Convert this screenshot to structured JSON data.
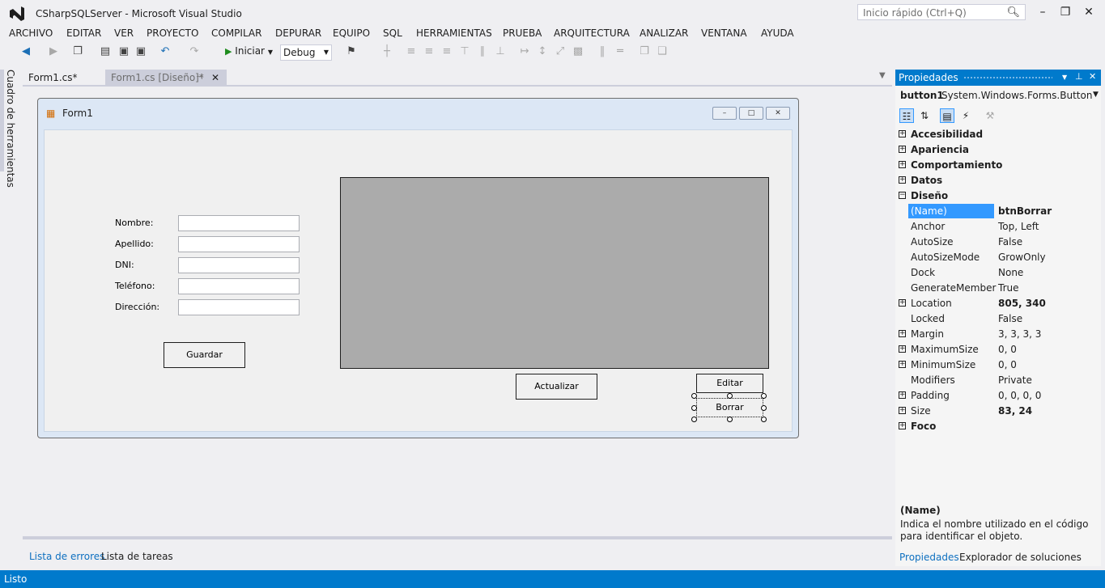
{
  "window": {
    "title": "CSharpSQLServer - Microsoft Visual Studio"
  },
  "quick_launch": {
    "placeholder": "Inicio rápido (Ctrl+Q)"
  },
  "menu": [
    "ARCHIVO",
    "EDITAR",
    "VER",
    "PROYECTO",
    "COMPILAR",
    "DEPURAR",
    "EQUIPO",
    "SQL",
    "HERRAMIENTAS",
    "PRUEBA",
    "ARQUITECTURA",
    "ANALIZAR",
    "VENTANA",
    "AYUDA"
  ],
  "toolbar": {
    "start_label": "Iniciar",
    "configuration": "Debug"
  },
  "toolbox": {
    "label": "Cuadro de herramientas"
  },
  "doc_tabs": {
    "code": "Form1.cs*",
    "design": "Form1.cs [Diseño]*"
  },
  "form": {
    "title": "Form1",
    "labels": {
      "nombre": "Nombre:",
      "apellido": "Apellido:",
      "dni": "DNI:",
      "telefono": "Teléfono:",
      "direccion": "Dirección:"
    },
    "buttons": {
      "guardar": "Guardar",
      "actualizar": "Actualizar",
      "editar": "Editar",
      "borrar": "Borrar"
    }
  },
  "bottom_tabs": {
    "errores": "Lista de errores",
    "tareas": "Lista de tareas"
  },
  "properties": {
    "title": "Propiedades",
    "object_name": "button1",
    "object_type": "System.Windows.Forms.Button",
    "categories": {
      "accesibilidad": "Accesibilidad",
      "apariencia": "Apariencia",
      "comportamiento": "Comportamiento",
      "datos": "Datos",
      "diseno": "Diseño",
      "foco": "Foco"
    },
    "rows": [
      {
        "name": "(Name)",
        "value": "btnBorrar",
        "bold": true,
        "expand": false,
        "selected": true
      },
      {
        "name": "Anchor",
        "value": "Top, Left",
        "bold": false,
        "expand": false
      },
      {
        "name": "AutoSize",
        "value": "False",
        "bold": false,
        "expand": false
      },
      {
        "name": "AutoSizeMode",
        "value": "GrowOnly",
        "bold": false,
        "expand": false
      },
      {
        "name": "Dock",
        "value": "None",
        "bold": false,
        "expand": false
      },
      {
        "name": "GenerateMember",
        "value": "True",
        "bold": false,
        "expand": false
      },
      {
        "name": "Location",
        "value": "805, 340",
        "bold": true,
        "expand": true
      },
      {
        "name": "Locked",
        "value": "False",
        "bold": false,
        "expand": false
      },
      {
        "name": "Margin",
        "value": "3, 3, 3, 3",
        "bold": false,
        "expand": true
      },
      {
        "name": "MaximumSize",
        "value": "0, 0",
        "bold": false,
        "expand": true
      },
      {
        "name": "MinimumSize",
        "value": "0, 0",
        "bold": false,
        "expand": true
      },
      {
        "name": "Modifiers",
        "value": "Private",
        "bold": false,
        "expand": false
      },
      {
        "name": "Padding",
        "value": "0, 0, 0, 0",
        "bold": false,
        "expand": true
      },
      {
        "name": "Size",
        "value": "83, 24",
        "bold": true,
        "expand": true
      }
    ],
    "description_title": "(Name)",
    "description_text": "Indica el nombre utilizado en el código para identificar el objeto.",
    "tabs": {
      "propiedades": "Propiedades",
      "explorador": "Explorador de soluciones"
    }
  },
  "status": {
    "text": "Listo"
  },
  "colors": {
    "accent": "#007ACC",
    "selection": "#3399FF",
    "grid": "#ABABAB"
  }
}
